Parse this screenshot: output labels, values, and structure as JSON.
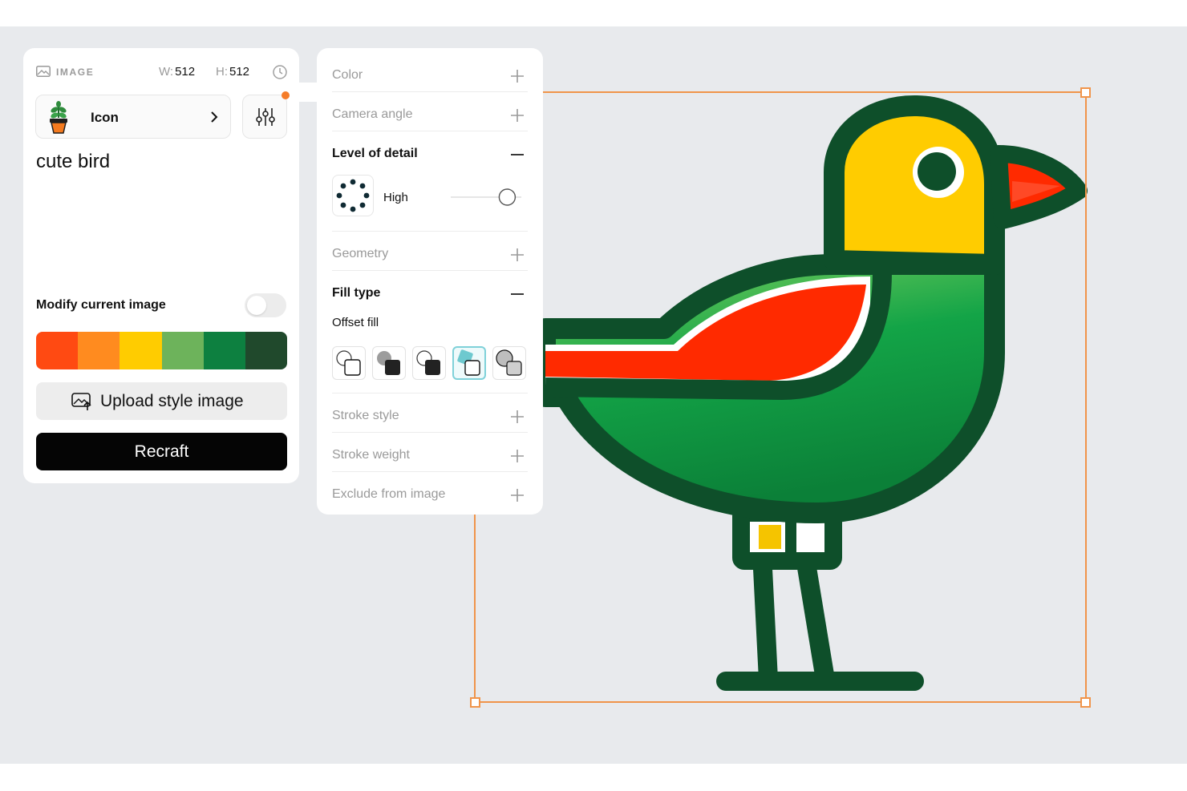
{
  "image_panel": {
    "section_label": "IMAGE",
    "width_key": "W:",
    "width_value": "512",
    "height_key": "H:",
    "height_value": "512",
    "style_name": "Icon",
    "prompt": "cute bird",
    "modify_label": "Modify current image",
    "modify_enabled": false,
    "palette": [
      "#ff4a12",
      "#ff8b1f",
      "#ffcc00",
      "#6db35b",
      "#0d8040",
      "#20492c"
    ],
    "upload_label": "Upload style image",
    "recraft_label": "Recraft"
  },
  "settings_panel": {
    "color_label": "Color",
    "camera_label": "Camera angle",
    "detail_label": "Level of detail",
    "detail_value": "High",
    "detail_level": 0.8,
    "geometry_label": "Geometry",
    "fill_type_label": "Fill type",
    "fill_type_value": "Offset fill",
    "fill_selected_index": 3,
    "stroke_style_label": "Stroke style",
    "stroke_weight_label": "Stroke weight",
    "exclude_label": "Exclude from image"
  },
  "colors": {
    "accent": "#f57c29",
    "selection": "#f0944a",
    "canvas": "#e8eaed",
    "bird_dark": "#0e4f2a",
    "bird_green": "#0c9a44",
    "bird_light_green": "#6cc95a",
    "bird_yellow": "#ffcc00",
    "bird_red": "#ff2a00"
  }
}
